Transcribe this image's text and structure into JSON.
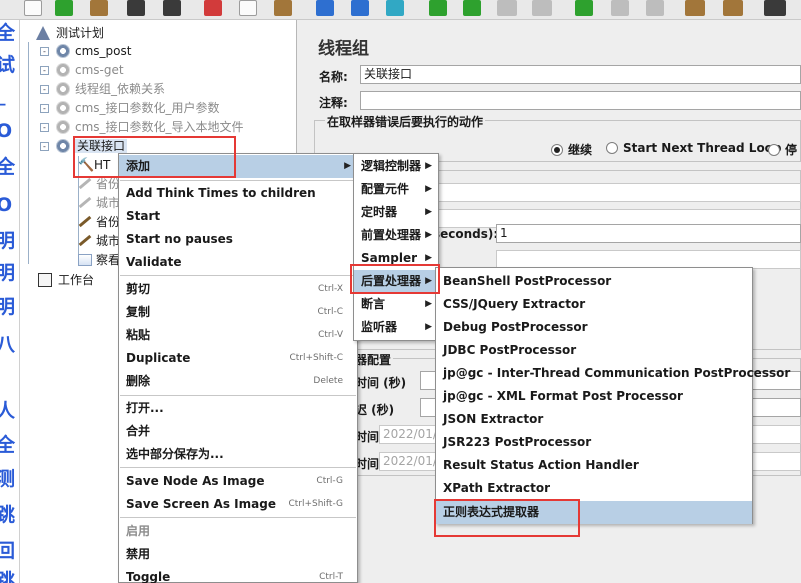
{
  "tree": {
    "items": [
      {
        "label": "测试计划"
      },
      {
        "label": "cms_post"
      },
      {
        "label": "cms-get"
      },
      {
        "label": "线程组_依赖关系"
      },
      {
        "label": "cms_接口参数化_用户参数"
      },
      {
        "label": "cms_接口参数化_导入本地文件"
      },
      {
        "label": "关联接口"
      },
      {
        "label": "HT"
      },
      {
        "label": "省份"
      },
      {
        "label": "城市"
      },
      {
        "label": "省份"
      },
      {
        "label": "城市"
      },
      {
        "label": "察看"
      },
      {
        "label": "工作台"
      }
    ]
  },
  "left_strip": [
    "全",
    "试",
    "_",
    "O",
    "全",
    "O",
    "明",
    "明",
    "明",
    "",
    "八",
    "",
    "人",
    "全",
    "测",
    "跳",
    "回",
    "跳"
  ],
  "panel": {
    "title": "线程组",
    "name_label": "名称:",
    "name_value": "关联接口",
    "comment_label": "注释:",
    "error_group_title": "在取样器错误后要执行的动作",
    "radio_continue": "继续",
    "radio_next_loop": "Start Next Thread Loop",
    "radio_stop": "停",
    "ramp_label": "seconds):",
    "ramp_value": "1",
    "sched_title": "器配置",
    "duration_label": "时间 (秒)",
    "delay_label": "迟 (秒)",
    "start_label": "时间",
    "start_value": "2022/01/",
    "end_label": "时间",
    "end_value": "2022/01/"
  },
  "context_menu": {
    "add": "添加",
    "think_times": "Add Think Times to children",
    "start": "Start",
    "start_no_pauses": "Start no pauses",
    "validate": "Validate",
    "cut": "剪切",
    "cut_sc": "Ctrl-X",
    "copy": "复制",
    "copy_sc": "Ctrl-C",
    "paste": "粘贴",
    "paste_sc": "Ctrl-V",
    "duplicate": "Duplicate",
    "duplicate_sc": "Ctrl+Shift-C",
    "delete": "删除",
    "delete_sc": "Delete",
    "open": "打开...",
    "merge": "合并",
    "save_selection": "选中部分保存为...",
    "save_node_image": "Save Node As Image",
    "save_node_image_sc": "Ctrl-G",
    "save_screen_image": "Save Screen As Image",
    "save_screen_image_sc": "Ctrl+Shift-G",
    "enable": "启用",
    "disable": "禁用",
    "toggle": "Toggle",
    "toggle_sc": "Ctrl-T"
  },
  "add_submenu": {
    "logic": "逻辑控制器",
    "config": "配置元件",
    "timer": "定时器",
    "pre": "前置处理器",
    "sampler": "Sampler",
    "post": "后置处理器",
    "assert": "断言",
    "listener": "监听器"
  },
  "post_submenu": {
    "items": [
      "BeanShell PostProcessor",
      "CSS/JQuery Extractor",
      "Debug PostProcessor",
      "JDBC PostProcessor",
      "jp@gc - Inter-Thread Communication PostProcessor",
      "jp@gc - XML Format Post Processor",
      "JSON Extractor",
      "JSR223 PostProcessor",
      "Result Status Action Handler",
      "XPath Extractor",
      "正则表达式提取器"
    ]
  },
  "colors": {
    "highlight": "#b8cfe5",
    "annotation_red": "#e53935"
  }
}
